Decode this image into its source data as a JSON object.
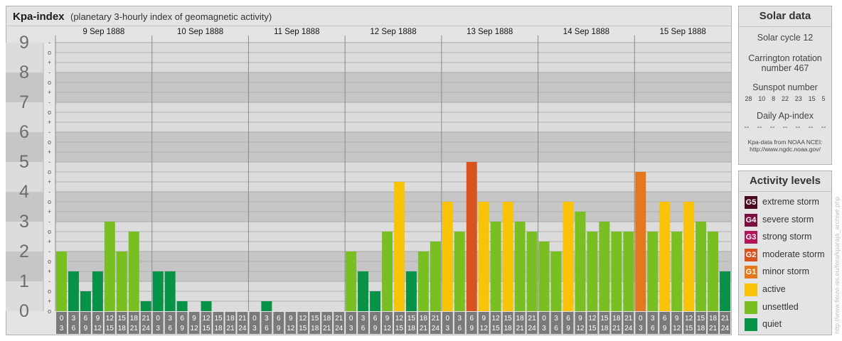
{
  "title": {
    "main": "Kpa-index",
    "sub": "(planetary 3-hourly index of geomagnetic activity)"
  },
  "chart_data": {
    "type": "bar",
    "y_ticks": [
      "0",
      "1",
      "2",
      "3",
      "4",
      "5",
      "6",
      "7",
      "8",
      "9"
    ],
    "sub_ticks": [
      "+",
      "o",
      "-"
    ],
    "top_sub_tick": "o",
    "ylim": [
      0,
      9
    ],
    "days": [
      "9 Sep 1888",
      "10 Sep 1888",
      "11 Sep 1888",
      "12 Sep 1888",
      "13 Sep 1888",
      "14 Sep 1888",
      "15 Sep 1888"
    ],
    "hour_labels": [
      [
        "0",
        "3"
      ],
      [
        "3",
        "6"
      ],
      [
        "6",
        "9"
      ],
      [
        "9",
        "12"
      ],
      [
        "12",
        "15"
      ],
      [
        "15",
        "18"
      ],
      [
        "18",
        "21"
      ],
      [
        "21",
        "24"
      ]
    ],
    "values": [
      [
        2.0,
        1.333,
        0.667,
        1.333,
        3.0,
        2.0,
        2.667,
        0.333
      ],
      [
        1.333,
        1.333,
        0.333,
        0,
        0.333,
        0,
        0,
        0
      ],
      [
        0,
        0.333,
        0,
        0,
        0,
        0,
        0,
        0
      ],
      [
        2.0,
        1.333,
        0.667,
        2.667,
        4.333,
        1.333,
        2.0,
        2.333
      ],
      [
        3.667,
        2.667,
        5.0,
        3.667,
        3.0,
        3.667,
        3.0,
        2.667
      ],
      [
        2.333,
        2.0,
        3.667,
        3.333,
        2.667,
        3.0,
        2.667,
        2.667
      ],
      [
        4.667,
        2.667,
        3.667,
        2.667,
        3.667,
        3.0,
        2.667,
        1.333
      ]
    ]
  },
  "solar_data": {
    "title": "Solar data",
    "solar_cycle": "Solar cycle 12",
    "carrington_line1": "Carrington rotation",
    "carrington_line2": "number 467",
    "sunspot_title": "Sunspot number",
    "sunspot_values": [
      "28",
      "10",
      "8",
      "22",
      "23",
      "15",
      "5"
    ],
    "ap_title": "Daily Ap-index",
    "ap_values": [
      "--",
      "--",
      "--",
      "--",
      "--",
      "--",
      "--"
    ],
    "credit_line1": "Kpa-data from NOAA NCEI:",
    "credit_line2": "http://www.ngdc.noaa.gov/"
  },
  "activity_levels": {
    "title": "Activity levels",
    "items": [
      {
        "code": "G5",
        "label": "extreme storm",
        "color": "#4a0a22"
      },
      {
        "code": "G4",
        "label": "severe storm",
        "color": "#7b1040"
      },
      {
        "code": "G3",
        "label": "strong storm",
        "color": "#b3155b"
      },
      {
        "code": "G2",
        "label": "moderate storm",
        "color": "#d9531e"
      },
      {
        "code": "G1",
        "label": "minor storm",
        "color": "#e5771e"
      },
      {
        "code": "",
        "label": "active",
        "color": "#f9c308"
      },
      {
        "code": "",
        "label": "unsettled",
        "color": "#7abf22"
      },
      {
        "code": "",
        "label": "quiet",
        "color": "#079247"
      }
    ]
  },
  "watermark": "http://www.fleuvi-iss.eu/fera/kparaja_archive.php"
}
